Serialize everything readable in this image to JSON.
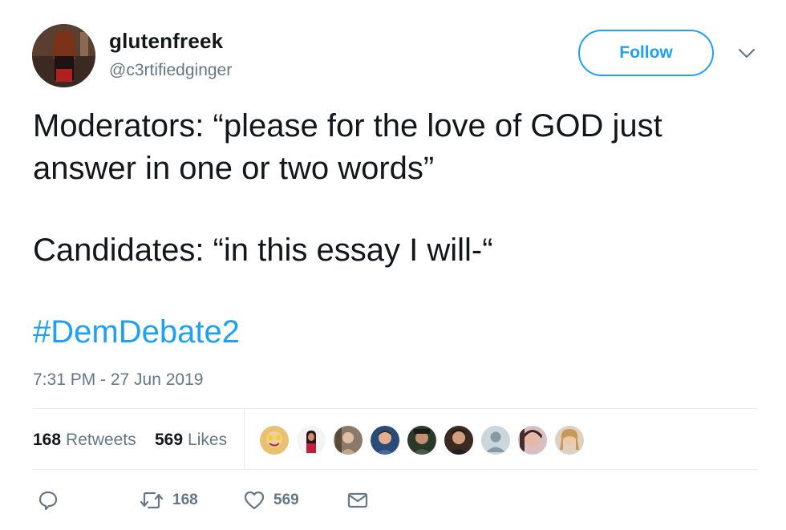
{
  "user": {
    "display_name": "glutenfreek",
    "handle": "@c3rtifiedginger",
    "follow_label": "Follow"
  },
  "tweet": {
    "line1": "Moderators: “please for the love of GOD just",
    "line2": "answer in one or two words”",
    "line3": "Candidates: “in this essay I will-“",
    "hashtag": "#DemDebate2",
    "timestamp": "7:31 PM - 27 Jun 2019"
  },
  "stats": {
    "retweets_count": "168",
    "retweets_label": "Retweets",
    "likes_count": "569",
    "likes_label": "Likes"
  },
  "actions": {
    "retweet_count": "168",
    "like_count": "569"
  },
  "colors": {
    "accent": "#1da1f2",
    "text": "#14171a",
    "muted": "#657786",
    "divider": "#e6ecf0"
  },
  "icons": [
    "chevron-down-icon",
    "reply-icon",
    "retweet-icon",
    "heart-icon",
    "mail-icon"
  ]
}
